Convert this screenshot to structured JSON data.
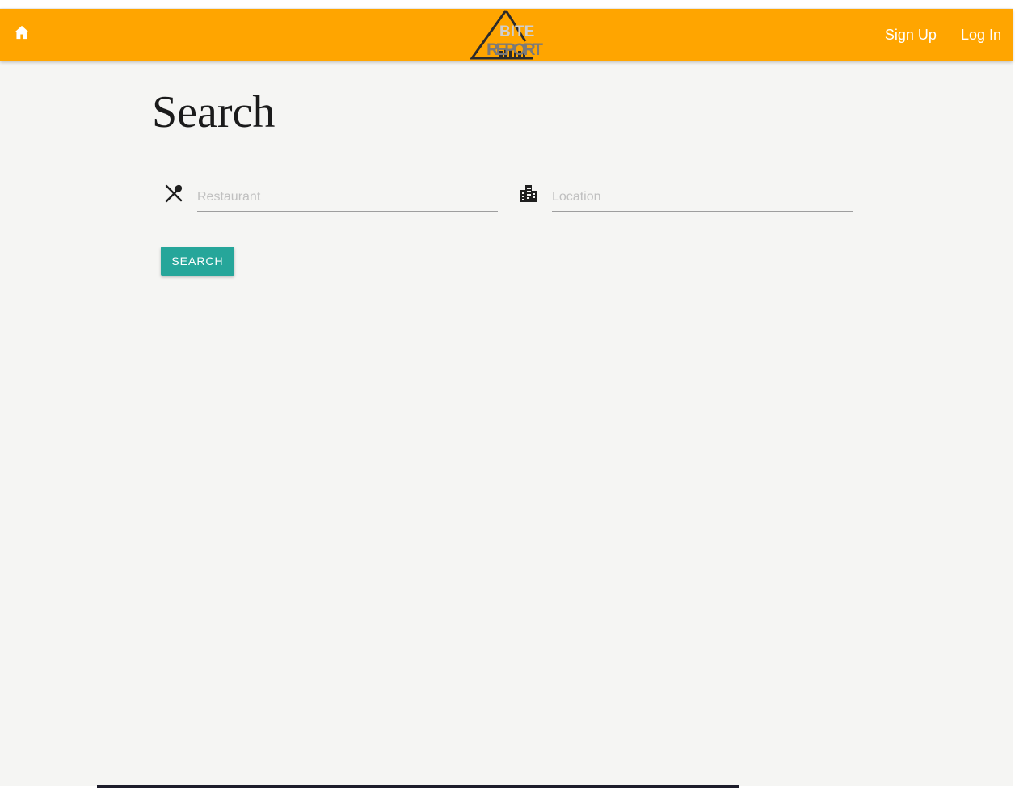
{
  "navbar": {
    "background": "#ffa500",
    "home_icon": "home-icon",
    "logo": {
      "line1": "BITE",
      "line2": "REPORT"
    },
    "links": {
      "signup": "Sign Up",
      "login": "Log In"
    }
  },
  "main": {
    "title": "Search",
    "restaurant_field": {
      "icon": "restaurant-icon",
      "placeholder": "Restaurant",
      "value": ""
    },
    "location_field": {
      "icon": "building-icon",
      "placeholder": "Location",
      "value": ""
    },
    "search_button": {
      "label": "SEARCH",
      "color": "#26a69a"
    }
  }
}
